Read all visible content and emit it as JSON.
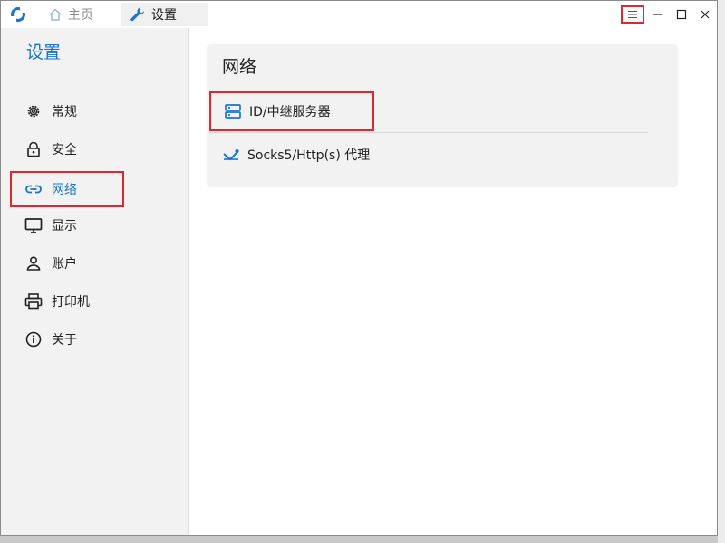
{
  "titlebar": {
    "tabs": [
      {
        "label": "主页",
        "icon": "home-icon"
      },
      {
        "label": "设置",
        "icon": "wrench-icon"
      }
    ],
    "controls": [
      "menu-icon",
      "minimize-icon",
      "maximize-icon",
      "close-icon"
    ]
  },
  "sidebar": {
    "title": "设置",
    "items": [
      {
        "label": "常规",
        "icon": "gear-icon"
      },
      {
        "label": "安全",
        "icon": "lock-icon"
      },
      {
        "label": "网络",
        "icon": "link-icon",
        "active": true
      },
      {
        "label": "显示",
        "icon": "monitor-icon"
      },
      {
        "label": "账户",
        "icon": "person-icon"
      },
      {
        "label": "打印机",
        "icon": "printer-icon"
      },
      {
        "label": "关于",
        "icon": "info-icon"
      }
    ]
  },
  "main": {
    "card": {
      "title": "网络",
      "rows": [
        {
          "label": "ID/中继服务器",
          "icon": "server-icon"
        },
        {
          "label": "Socks5/Http(s) 代理",
          "icon": "proxy-icon"
        }
      ]
    }
  },
  "colors": {
    "accent": "#1a73d1",
    "highlight": "#e0272f",
    "sidebar_bg": "#f2f2f3",
    "card_bg": "#f2f2f3"
  }
}
